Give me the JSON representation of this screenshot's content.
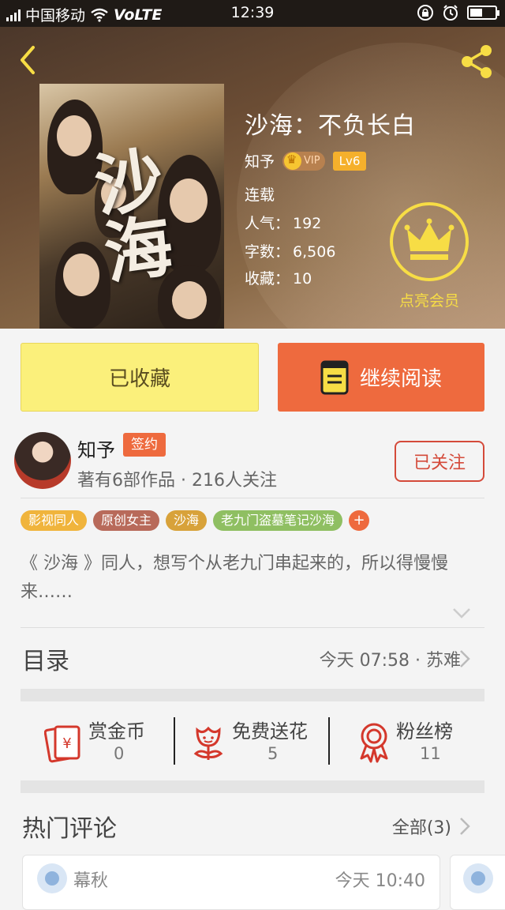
{
  "status_bar": {
    "carrier": "中国移动",
    "network": "VoLTE",
    "time": "12:39"
  },
  "book": {
    "title": "沙海：不负长白",
    "cover_calligraphy": "沙海",
    "author": "知予",
    "vip_label": "VIP",
    "level": "Lv6",
    "status": "连载",
    "popularity_label": "人气：",
    "popularity": "192",
    "words_label": "字数：",
    "words": "6,506",
    "favorites_label": "收藏：",
    "favorites": "10",
    "member_label": "点亮会员"
  },
  "actions": {
    "collected": "已收藏",
    "continue_reading": "继续阅读"
  },
  "author": {
    "name": "知予",
    "badge": "签约",
    "stats": "著有6部作品 · 216人关注",
    "follow": "已关注"
  },
  "tags": [
    {
      "label": "影视同人",
      "color": "#f0b43c"
    },
    {
      "label": "原创女主",
      "color": "#b86a5a"
    },
    {
      "label": "沙海",
      "color": "#d8a23a"
    },
    {
      "label": "老九门盗墓笔记沙海",
      "color": "#8fbf62"
    }
  ],
  "tag_add": "+",
  "description": "《 沙海 》同人，想写个从老九门串起来的，所以得慢慢来……",
  "catalog": {
    "title": "目录",
    "latest": "今天 07:58 · 苏难"
  },
  "rewards": [
    {
      "label": "赏金币",
      "value": "0"
    },
    {
      "label": "免费送花",
      "value": "5"
    },
    {
      "label": "粉丝榜",
      "value": "11"
    }
  ],
  "comments": {
    "title": "热门评论",
    "all": "全部(3)",
    "items": [
      {
        "name": "幕秋",
        "time": "今天 10:40"
      }
    ]
  },
  "colors": {
    "accent": "#ee6a3e",
    "collected_bg": "#fbf07b",
    "crown": "#f7dd45",
    "follow": "#d44a3a"
  }
}
